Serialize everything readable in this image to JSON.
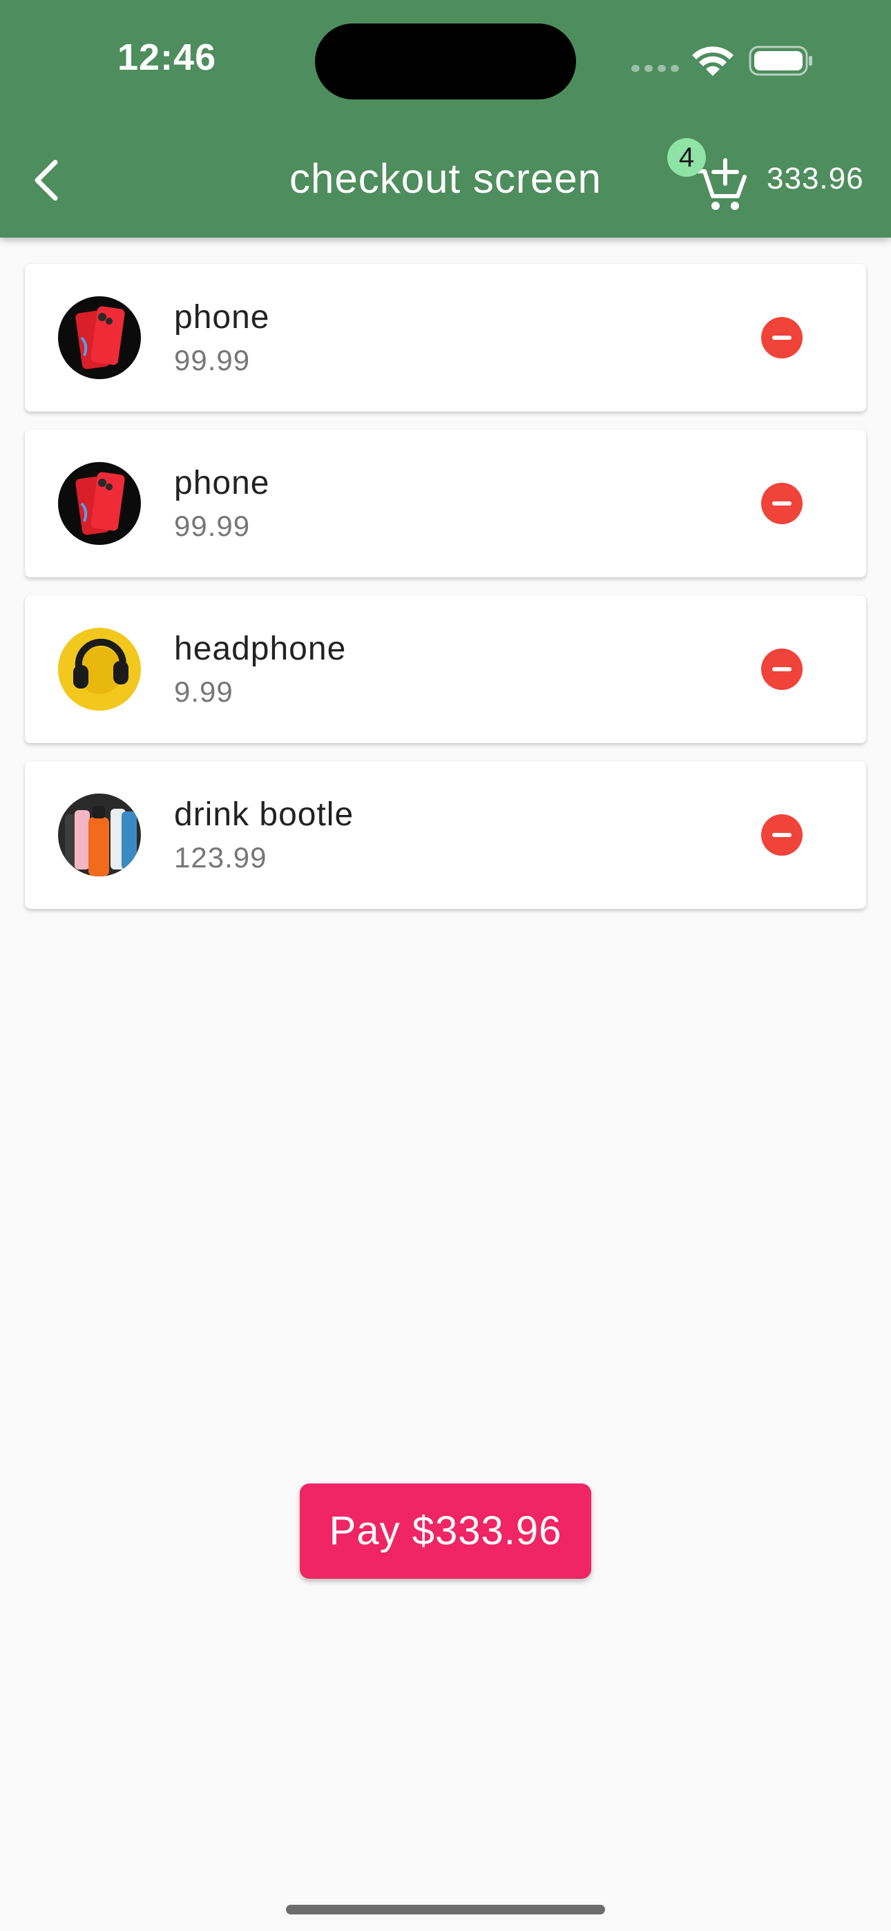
{
  "status_bar": {
    "time": "12:46"
  },
  "app_bar": {
    "title": "checkout screen",
    "back_icon": "chevron-left-icon",
    "cart_icon": "add-shopping-cart-icon",
    "cart_count": "4",
    "cart_total": "333.96"
  },
  "items": [
    {
      "name": "phone",
      "price": "99.99",
      "image": "red-phone"
    },
    {
      "name": "phone",
      "price": "99.99",
      "image": "red-phone"
    },
    {
      "name": "headphone",
      "price": "9.99",
      "image": "headphones-on-yellow"
    },
    {
      "name": "drink bootle",
      "price": "123.99",
      "image": "water-bottles"
    }
  ],
  "pay_button": {
    "label": "Pay $333.96"
  },
  "colors": {
    "app_bar": "#4e8d5d",
    "badge": "#8fe3a6",
    "remove": "#f0433a",
    "pay": "#ef2565",
    "background": "#fafafa"
  }
}
